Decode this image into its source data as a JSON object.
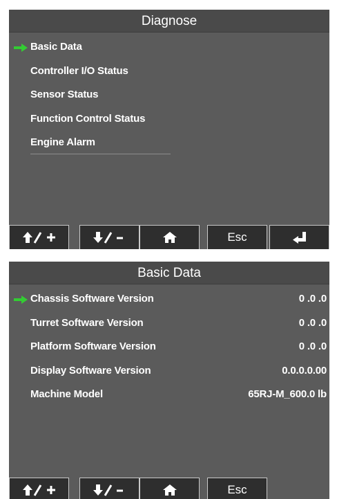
{
  "colors": {
    "arrow": "#33cc33",
    "screen_bg": "#5b5b5b",
    "button_bg": "#2e2e2e",
    "text": "#ffffff"
  },
  "screen1": {
    "title": "Diagnose",
    "items": [
      {
        "label": "Basic Data",
        "selected": true
      },
      {
        "label": "Controller I/O Status"
      },
      {
        "label": "Sensor Status"
      },
      {
        "label": "Function Control Status"
      },
      {
        "label": "Engine Alarm"
      }
    ],
    "buttons": [
      "up-plus-icon",
      "down-minus-icon",
      "home-icon",
      "Esc",
      "enter-icon"
    ]
  },
  "screen2": {
    "title": "Basic Data",
    "items": [
      {
        "label": "Chassis Software Version",
        "value": "0 .0 .0",
        "selected": true
      },
      {
        "label": "Turret Software Version",
        "value": "0 .0 .0"
      },
      {
        "label": "Platform Software Version",
        "value": "0 .0 .0"
      },
      {
        "label": "Display Software Version",
        "value": "0.0.0.0.00"
      },
      {
        "label": "Machine Model",
        "value": "65RJ-M_600.0 lb"
      }
    ],
    "buttons": [
      "up-plus-icon",
      "down-minus-icon",
      "home-icon",
      "Esc"
    ]
  }
}
